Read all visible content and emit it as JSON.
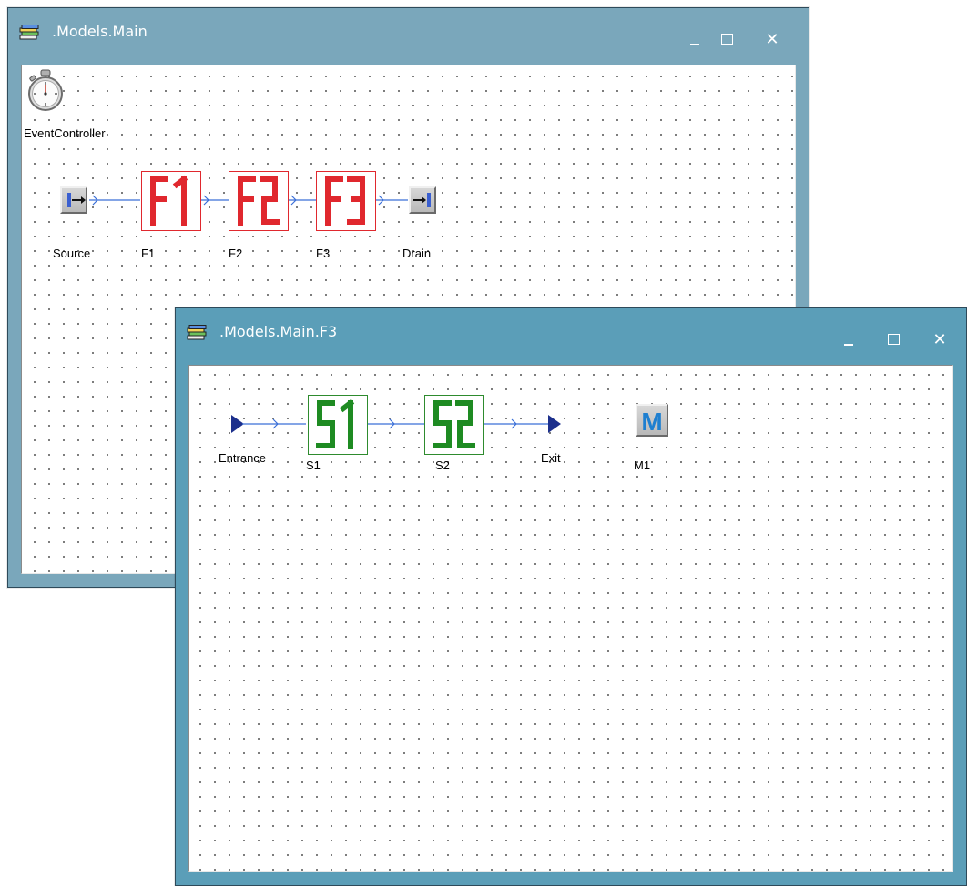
{
  "main_window": {
    "title": ".Models.Main",
    "controls": {
      "minimize": "_",
      "maximize": "□",
      "close": "✕"
    },
    "objects": [
      {
        "id": "event-controller",
        "label": "EventController",
        "icon": "stopwatch-icon"
      },
      {
        "id": "source",
        "label": "Source",
        "icon": "source-icon"
      },
      {
        "id": "f1",
        "label": "F1",
        "icon": "frame-icon",
        "glyph": "F1",
        "color": "#e0282e"
      },
      {
        "id": "f2",
        "label": "F2",
        "icon": "frame-icon",
        "glyph": "F2",
        "color": "#e0282e"
      },
      {
        "id": "f3",
        "label": "F3",
        "icon": "frame-icon",
        "glyph": "F3",
        "color": "#e0282e"
      },
      {
        "id": "drain",
        "label": "Drain",
        "icon": "drain-icon"
      }
    ]
  },
  "f3_window": {
    "title": ".Models.Main.F3",
    "controls": {
      "minimize": "_",
      "maximize": "□",
      "close": "✕"
    },
    "objects": [
      {
        "id": "entrance",
        "label": "Entrance",
        "icon": "entrance-triangle-icon"
      },
      {
        "id": "s1",
        "label": "S1",
        "icon": "station-icon",
        "glyph": "S1",
        "color": "#2e8b2e"
      },
      {
        "id": "s2",
        "label": "S2",
        "icon": "station-icon",
        "glyph": "S2",
        "color": "#2e8b2e"
      },
      {
        "id": "exit",
        "label": "Exit",
        "icon": "exit-triangle-icon"
      },
      {
        "id": "m1",
        "label": "M1",
        "icon": "method-icon",
        "glyph": "M",
        "color": "#1e7fd0"
      }
    ]
  },
  "colors": {
    "main_titlebar": "#7aa7bb",
    "f3_titlebar": "#5b9eb8",
    "connector": "#3a6fd8"
  }
}
